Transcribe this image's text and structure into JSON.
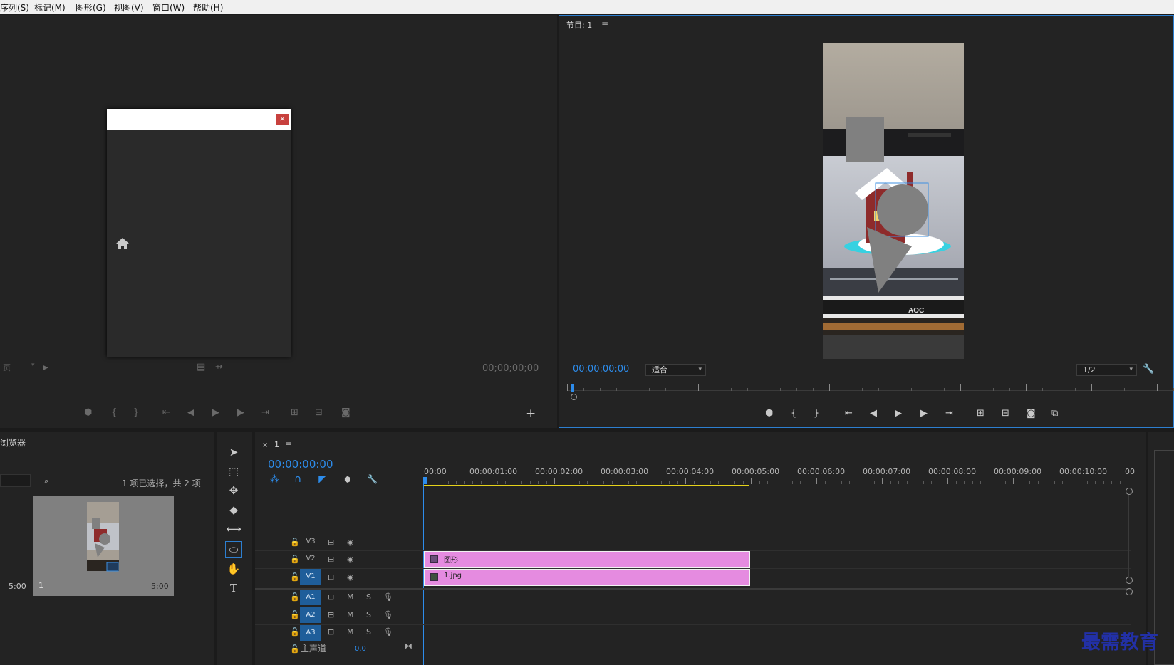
{
  "menu": {
    "items": [
      "序列(S)",
      "标记(M)",
      "图形(G)",
      "视图(V)",
      "窗口(W)",
      "帮助(H)"
    ]
  },
  "source_monitor": {
    "page_select": "页",
    "timecode": "00;00;00;00",
    "dialog_close": "×"
  },
  "program_monitor": {
    "title": "节目: 1",
    "timecode": "00:00:00:00",
    "zoom": "适合",
    "resolution": "1/2",
    "video_brand": "AOC"
  },
  "project": {
    "title": "浏览器",
    "selection_info": "1 项已选择，共 2 项",
    "item_left_duration": "5:00",
    "item_name": "1",
    "item_duration": "5:00"
  },
  "timeline": {
    "tab_close": "×",
    "tab_name": "1",
    "timecode": "00:00:00:00",
    "ruler": [
      "00:00",
      "00:00:01:00",
      "00:00:02:00",
      "00:00:03:00",
      "00:00:04:00",
      "00:00:05:00",
      "00:00:06:00",
      "00:00:07:00",
      "00:00:08:00",
      "00:00:09:00",
      "00:00:10:00",
      "00"
    ],
    "tracks": {
      "v3": "V3",
      "v2": "V2",
      "v1": "V1",
      "a1": "A1",
      "a2": "A2",
      "a3": "A3",
      "mute": "M",
      "solo": "S",
      "master": "主声道",
      "master_value": "0.0"
    },
    "clips": {
      "graphic": "图形",
      "image": "1.jpg"
    }
  },
  "watermark": "最需教育",
  "colors": {
    "accent": "#2d8ceb",
    "clip": "#e58be0",
    "work_area": "#e5d21a",
    "close_red": "#c8413e"
  }
}
